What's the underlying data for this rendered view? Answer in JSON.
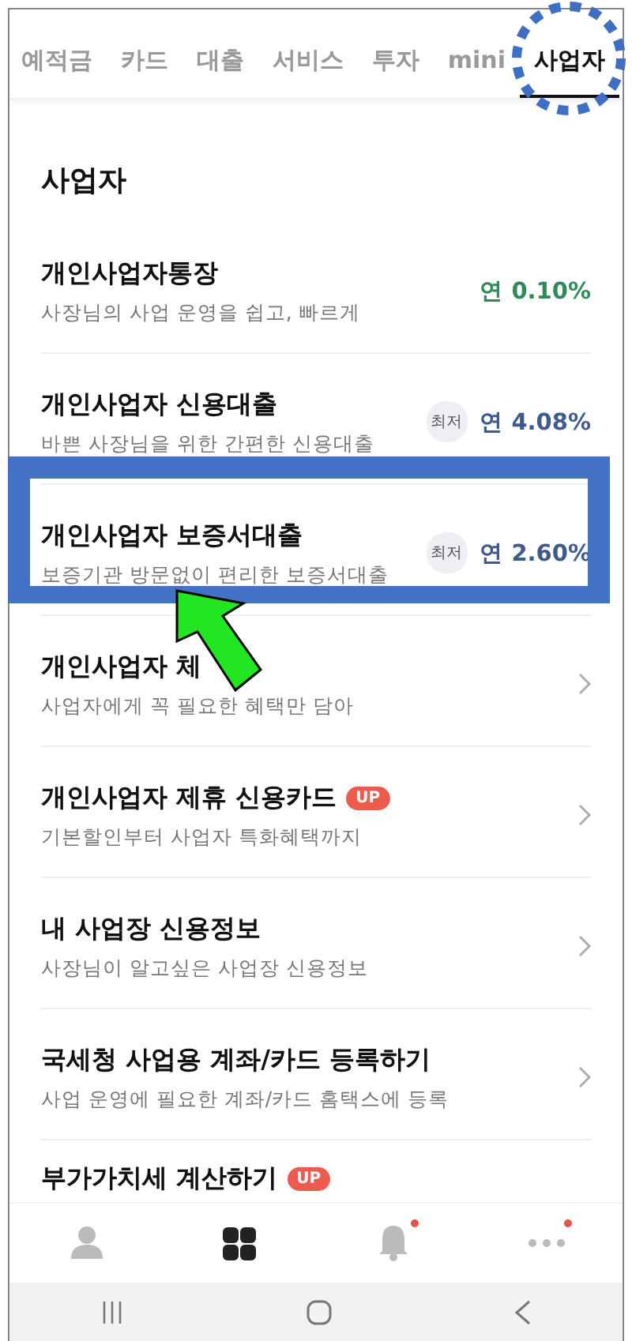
{
  "tabs": [
    {
      "label": "예적금",
      "selected": false
    },
    {
      "label": "카드",
      "selected": false
    },
    {
      "label": "대출",
      "selected": false
    },
    {
      "label": "서비스",
      "selected": false
    },
    {
      "label": "투자",
      "selected": false
    },
    {
      "label": "mini",
      "selected": false
    },
    {
      "label": "사업자",
      "selected": true
    }
  ],
  "section_title": "사업자",
  "products": [
    {
      "kind": "rate",
      "title": "개인사업자통장",
      "subtitle": "사장님의 사업 운영을 쉽고, 빠르게",
      "rate": "연 0.10%",
      "color": "#2e8b57"
    },
    {
      "kind": "rate",
      "title": "개인사업자 신용대출",
      "subtitle": "바쁜 사장님을 위한 간편한 신용대출",
      "tag": "최저",
      "rate": "연 4.08%",
      "color": "#3f5a8c"
    },
    {
      "kind": "rate",
      "title": "개인사업자 보증서대출",
      "subtitle": "보증기관 방문없이 편리한 보증서대출",
      "tag": "최저",
      "rate": "연 2.60%",
      "color": "#3f5a8c"
    },
    {
      "kind": "link",
      "title": "개인사업자 체",
      "subtitle": "사업자에게 꼭 필요한 혜택만 담아"
    },
    {
      "kind": "link",
      "title": "개인사업자 제휴 신용카드",
      "badge": "UP",
      "subtitle": "기본할인부터 사업자 특화혜택까지"
    },
    {
      "kind": "link",
      "title": "내 사업장 신용정보",
      "subtitle": "사장님이 알고싶은 사업장 신용정보"
    },
    {
      "kind": "link",
      "title": "국세청 사업용 계좌/카드 등록하기",
      "subtitle": "사업 운영에 필요한 계좌/카드 홈택스에 등록"
    },
    {
      "kind": "link",
      "title": "부가가치세 계산하기",
      "badge": "UP"
    }
  ],
  "bottom_nav": [
    {
      "kind": "person",
      "selected": false,
      "dot": false
    },
    {
      "kind": "grid",
      "selected": true,
      "dot": false
    },
    {
      "kind": "bell",
      "selected": false,
      "dot": true
    },
    {
      "kind": "more",
      "selected": false,
      "dot": true
    }
  ]
}
